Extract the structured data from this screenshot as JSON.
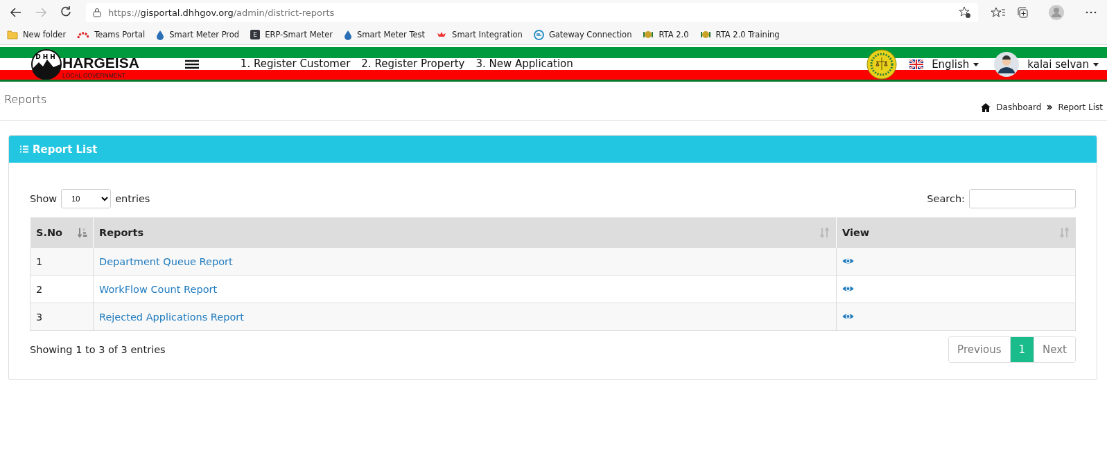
{
  "browser": {
    "url": {
      "scheme": "https://",
      "host": "gisportal.dhhgov.org",
      "path": "/admin/district-reports"
    },
    "bookmarks": [
      {
        "kind": "folder",
        "label": "New folder"
      },
      {
        "kind": "arc",
        "label": "Teams Portal"
      },
      {
        "kind": "drop",
        "label": "Smart Meter Prod"
      },
      {
        "kind": "letter",
        "letter": "E",
        "label": "ERP-Smart Meter"
      },
      {
        "kind": "drop",
        "label": "Smart Meter Test"
      },
      {
        "kind": "flower",
        "label": "Smart Integration"
      },
      {
        "kind": "swirl",
        "label": "Gateway Connection"
      },
      {
        "kind": "emblem",
        "label": "RTA 2.0"
      },
      {
        "kind": "emblem",
        "label": "RTA 2.0 Training"
      }
    ]
  },
  "header": {
    "logo": {
      "letters": "DHH",
      "name": "HARGEISA",
      "subtitle": "LOCAL GOVERNMENT"
    },
    "nav": [
      "1. Register Customer",
      "2. Register Property",
      "3. New Application"
    ],
    "language": "English",
    "user": "kalai selvan"
  },
  "page": {
    "title": "Reports",
    "breadcrumb": [
      "Dashboard",
      "Report List"
    ]
  },
  "card": {
    "title": "Report List",
    "length": {
      "before": "Show",
      "value": "10",
      "after": "entries"
    },
    "search": {
      "label": "Search:"
    },
    "table": {
      "columns": [
        {
          "label": "S.No",
          "sorted": true
        },
        {
          "label": "Reports",
          "sorted": false
        },
        {
          "label": "View",
          "sorted": false
        }
      ],
      "rows": [
        {
          "sno": "1",
          "report": "Department Queue Report"
        },
        {
          "sno": "2",
          "report": "WorkFlow Count Report"
        },
        {
          "sno": "3",
          "report": "Rejected Applications Report"
        }
      ]
    },
    "info": "Showing 1 to 3 of 3 entries",
    "pagination": [
      {
        "label": "Previous",
        "disabled": true,
        "selected": false
      },
      {
        "label": "1",
        "disabled": false,
        "selected": true
      },
      {
        "label": "Next",
        "disabled": true,
        "selected": false
      }
    ]
  }
}
